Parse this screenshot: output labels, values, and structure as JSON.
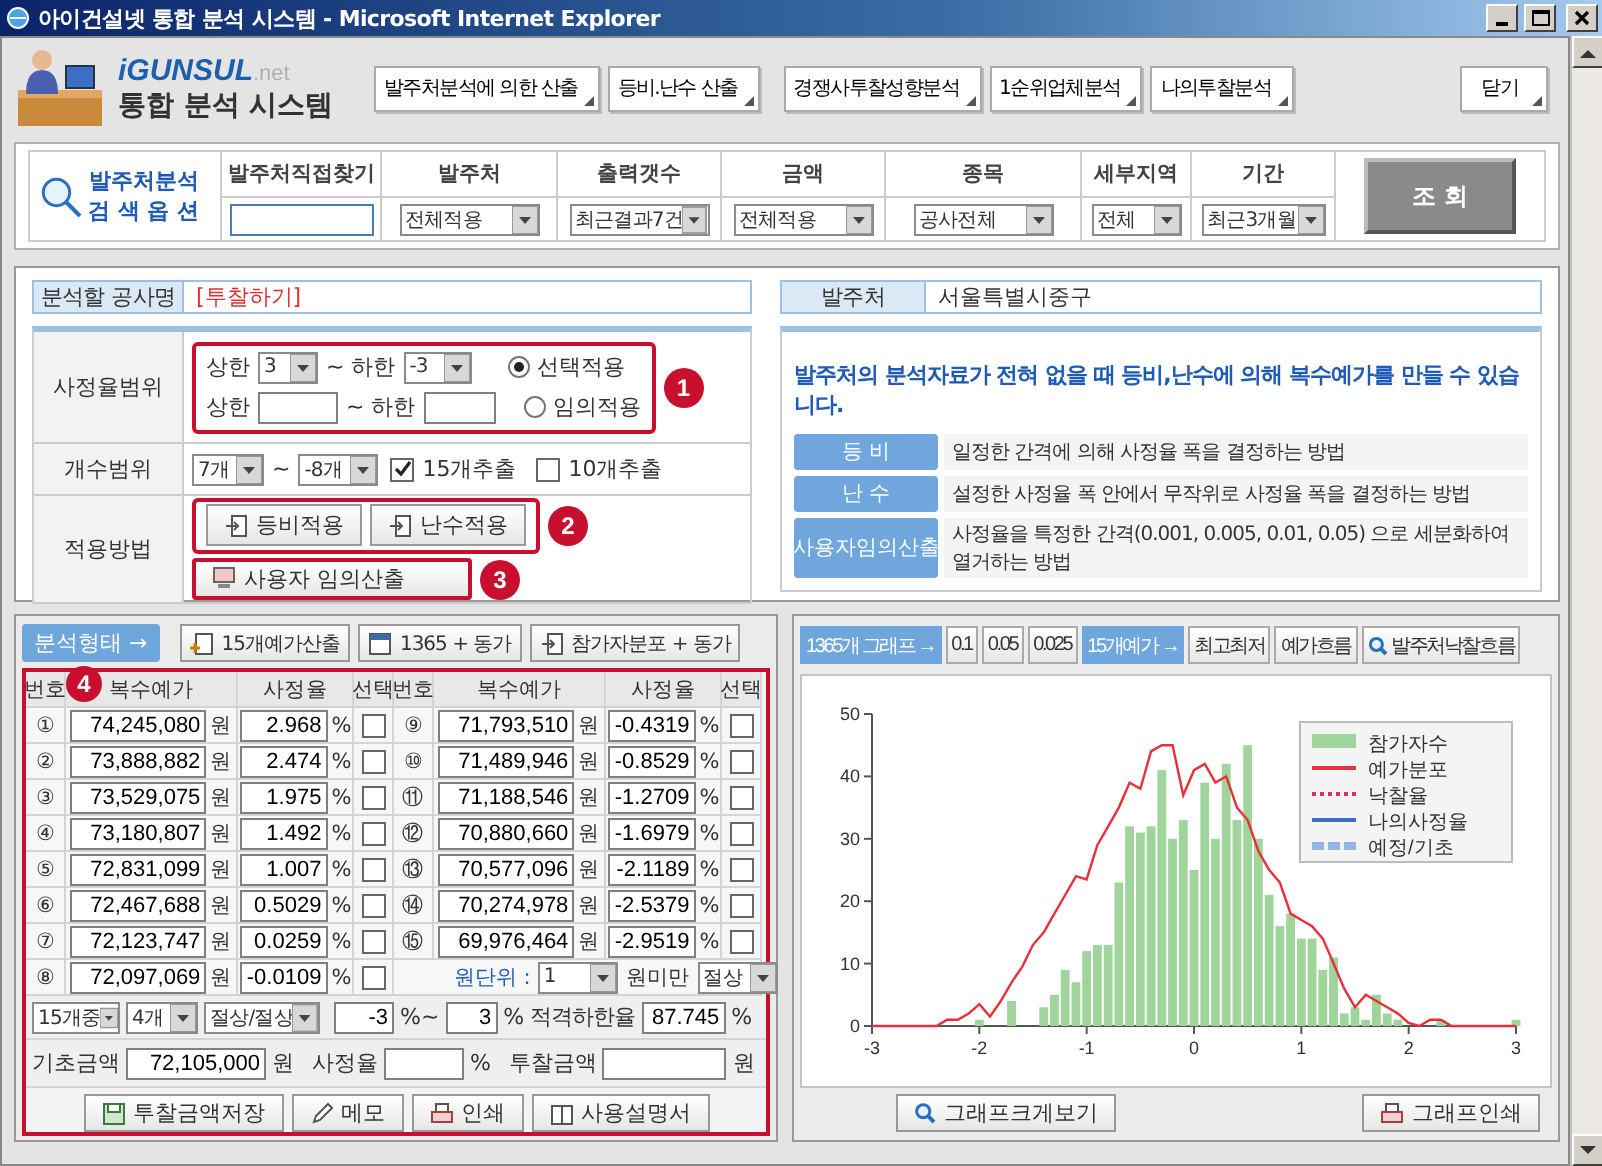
{
  "window": {
    "title": "아이건설넷 통합 분석 시스템 - Microsoft Internet Explorer"
  },
  "header": {
    "brand": "iGUNSUL",
    "brand_suffix": ".net",
    "system_title": "통합 분석 시스템",
    "nav": [
      {
        "label": "발주처분석에 의한 산출"
      },
      {
        "label": "등비.난수 산출"
      },
      {
        "label": "경쟁사투찰성향분석"
      },
      {
        "label": "1순위업체분석"
      },
      {
        "label": "나의투찰분석"
      }
    ],
    "close": "닫기"
  },
  "search": {
    "title": "발주처분석",
    "subtitle": "검 색 옵 션",
    "fields": [
      {
        "label": "발주처직접찾기",
        "kind": "input"
      },
      {
        "label": "발주처",
        "kind": "select",
        "value": "전체적용"
      },
      {
        "label": "출력갯수",
        "kind": "select",
        "value": "최근결과7건"
      },
      {
        "label": "금액",
        "kind": "select",
        "value": "전체적용"
      },
      {
        "label": "종목",
        "kind": "select",
        "value": "공사전체"
      },
      {
        "label": "세부지역",
        "kind": "select",
        "value": "전체"
      },
      {
        "label": "기간",
        "kind": "select",
        "value": "최근3개월"
      }
    ],
    "button": "조 회"
  },
  "project": {
    "label": "분석할 공사명",
    "value": "[투찰하기]",
    "client_label": "발주처",
    "client_value": "서울특별시중구"
  },
  "settings": {
    "rate_range": {
      "label": "사정율범위",
      "upper_label": "상한",
      "upper": "3",
      "lower_label": "~ 하한",
      "lower": "-3",
      "custom_upper_label": "상한",
      "custom_lower_label": "~ 하한",
      "modes": [
        {
          "label": "선택적용",
          "selected": true
        },
        {
          "label": "임의적용",
          "selected": false
        }
      ],
      "badge": "1"
    },
    "count_range": {
      "label": "개수범위",
      "from": "7개",
      "sep": "~",
      "to": "-8개",
      "extract": [
        {
          "label": "15개추출",
          "checked": true
        },
        {
          "label": "10개추출",
          "checked": false
        }
      ]
    },
    "method": {
      "label": "적용방법",
      "buttons": [
        "등비적용",
        "난수적용"
      ],
      "badge": "2",
      "custom_button": "사용자 임의산출",
      "custom_badge": "3"
    }
  },
  "info": {
    "headline": "발주처의 분석자료가 전혀 없을 때 등비,난수에 의해 복수예가를 만들 수 있습니다.",
    "items": [
      {
        "tag": "등 비",
        "desc": "일정한 간격에 의해 사정율 폭을 결정하는 방법"
      },
      {
        "tag": "난 수",
        "desc": "설정한 사정율 폭 안에서 무작위로 사정율 폭을 결정하는 방법"
      },
      {
        "tag": "사용자임의산출",
        "desc": "사정율을 특정한 간격(0.001, 0.005, 0.01, 0.05) 으로 세분화하여 열거하는 방법"
      }
    ]
  },
  "estimates": {
    "mode_label": "분석형태 →",
    "actions": [
      "15개예가산출",
      "1365 + 동가",
      "참가자분포 + 동가"
    ],
    "badge": "4",
    "columns": [
      "번호",
      "복수예가",
      "사정율",
      "선택",
      "번호",
      "복수예가",
      "사정율",
      "선택"
    ],
    "rows": [
      {
        "no": "①",
        "price": "74,245,080",
        "won": "원",
        "rate": "2.968",
        "pct": "%",
        "checked": false
      },
      {
        "no": "②",
        "price": "73,888,882",
        "won": "원",
        "rate": "2.474",
        "pct": "%",
        "checked": false
      },
      {
        "no": "③",
        "price": "73,529,075",
        "won": "원",
        "rate": "1.975",
        "pct": "%",
        "checked": false
      },
      {
        "no": "④",
        "price": "73,180,807",
        "won": "원",
        "rate": "1.492",
        "pct": "%",
        "checked": false
      },
      {
        "no": "⑤",
        "price": "72,831,099",
        "won": "원",
        "rate": "1.007",
        "pct": "%",
        "checked": false
      },
      {
        "no": "⑥",
        "price": "72,467,688",
        "won": "원",
        "rate": "0.5029",
        "pct": "%",
        "checked": false
      },
      {
        "no": "⑦",
        "price": "72,123,747",
        "won": "원",
        "rate": "0.0259",
        "pct": "%",
        "checked": false
      },
      {
        "no": "⑧",
        "price": "72,097,069",
        "won": "원",
        "rate": "-0.0109",
        "pct": "%",
        "checked": false
      },
      {
        "no": "⑨",
        "price": "71,793,510",
        "won": "원",
        "rate": "-0.4319",
        "pct": "%",
        "checked": false
      },
      {
        "no": "⑩",
        "price": "71,489,946",
        "won": "원",
        "rate": "-0.8529",
        "pct": "%",
        "checked": false
      },
      {
        "no": "⑪",
        "price": "71,188,546",
        "won": "원",
        "rate": "-1.2709",
        "pct": "%",
        "checked": false
      },
      {
        "no": "⑫",
        "price": "70,880,660",
        "won": "원",
        "rate": "-1.6979",
        "pct": "%",
        "checked": false
      },
      {
        "no": "⑬",
        "price": "70,577,096",
        "won": "원",
        "rate": "-2.1189",
        "pct": "%",
        "checked": false
      },
      {
        "no": "⑭",
        "price": "70,274,978",
        "won": "원",
        "rate": "-2.5379",
        "pct": "%",
        "checked": false
      },
      {
        "no": "⑮",
        "price": "69,976,464",
        "won": "원",
        "rate": "-2.9519",
        "pct": "%",
        "checked": false
      }
    ],
    "unit_label": "원단위 :",
    "unit": "1",
    "below_label": "원미만",
    "rounding": "절상",
    "filters": {
      "pick": "15개중",
      "count": "4개",
      "round": "절상/절상",
      "from": "-3",
      "from_unit": "%~",
      "to": "3",
      "to_unit": "%",
      "floor_label": "적격하한율",
      "floor": "87.745",
      "floor_unit": "%"
    },
    "base": {
      "label": "기초금액",
      "value": "72,105,000",
      "unit": "원",
      "rate_label": "사정율",
      "rate_unit": "%",
      "bid_label": "투찰금액",
      "bid_unit": "원"
    },
    "buttons": [
      "투찰금액저장",
      "메모",
      "인쇄",
      "사용설명서"
    ]
  },
  "graph": {
    "toolbar": [
      {
        "label": "1365개 그래프 →",
        "kind": "tag"
      },
      {
        "label": "0.1",
        "kind": "button"
      },
      {
        "label": "0.05",
        "kind": "button"
      },
      {
        "label": "0.025",
        "kind": "button"
      },
      {
        "label": "15개예가 →",
        "kind": "tag"
      },
      {
        "label": "최고최저",
        "kind": "button"
      },
      {
        "label": "예가흐름",
        "kind": "button"
      },
      {
        "label": "발주처낙찰흐름",
        "kind": "search"
      }
    ],
    "chart_data": {
      "type": "bar",
      "xlim": [
        -3,
        3
      ],
      "ylim": [
        0,
        50
      ],
      "xticks": [
        -3,
        -2,
        -1,
        0,
        1,
        2,
        3
      ],
      "yticks": [
        0,
        10,
        20,
        30,
        40,
        50
      ],
      "x": [
        -3,
        -2.9,
        -2.8,
        -2.7,
        -2.6,
        -2.5,
        -2.4,
        -2.3,
        -2.2,
        -2.1,
        -2,
        -1.9,
        -1.8,
        -1.7,
        -1.6,
        -1.5,
        -1.4,
        -1.3,
        -1.2,
        -1.1,
        -1,
        -0.9,
        -0.8,
        -0.7,
        -0.6,
        -0.5,
        -0.4,
        -0.3,
        -0.2,
        -0.1,
        0,
        0.1,
        0.2,
        0.3,
        0.4,
        0.5,
        0.6,
        0.7,
        0.8,
        0.9,
        1,
        1.1,
        1.2,
        1.3,
        1.4,
        1.5,
        1.6,
        1.7,
        1.8,
        1.9,
        2,
        2.1,
        2.2,
        2.3,
        2.4,
        2.5,
        2.6,
        2.7,
        2.8,
        2.9,
        3
      ],
      "legend": "upper right",
      "series": [
        {
          "name": "참가자수",
          "color": "#9fd49a",
          "values": [
            null,
            null,
            null,
            null,
            null,
            null,
            null,
            null,
            null,
            null,
            1,
            null,
            null,
            4,
            null,
            null,
            3,
            5,
            9,
            7,
            12,
            13,
            13,
            23,
            32,
            31,
            32,
            41,
            30,
            33,
            25,
            39,
            30,
            42,
            33,
            45,
            30,
            21,
            16,
            18,
            14,
            14,
            9,
            11,
            2,
            3,
            1,
            5,
            2,
            1,
            null,
            null,
            null,
            1,
            null,
            null,
            null,
            null,
            null,
            null,
            1
          ]
        },
        {
          "name": "예가분포",
          "type": "line",
          "color": "#e8303a",
          "values": [
            0,
            0,
            0,
            0,
            0,
            0,
            0,
            1,
            1,
            2,
            3.5,
            1.5,
            4,
            7,
            9.5,
            13,
            15,
            18,
            21,
            24,
            23.5,
            29,
            32,
            35,
            39,
            38,
            44,
            45,
            45,
            37,
            41,
            42,
            39,
            40,
            35,
            33,
            28,
            25,
            23,
            18,
            17,
            16,
            14,
            10,
            6,
            3,
            5,
            4,
            3,
            2,
            0.5,
            0,
            1,
            1,
            0,
            0,
            0,
            0,
            0,
            0,
            0
          ]
        }
      ]
    },
    "legend_extra": [
      {
        "label": "낙찰율",
        "kind": "dashed",
        "color": "#e0306a"
      },
      {
        "label": "나의사정율",
        "kind": "line",
        "color": "#3b6fc4"
      },
      {
        "label": "예정/기초",
        "kind": "band",
        "color": "#8fb8e8"
      }
    ],
    "buttons": [
      "그래프크게보기",
      "그래프인쇄"
    ]
  }
}
